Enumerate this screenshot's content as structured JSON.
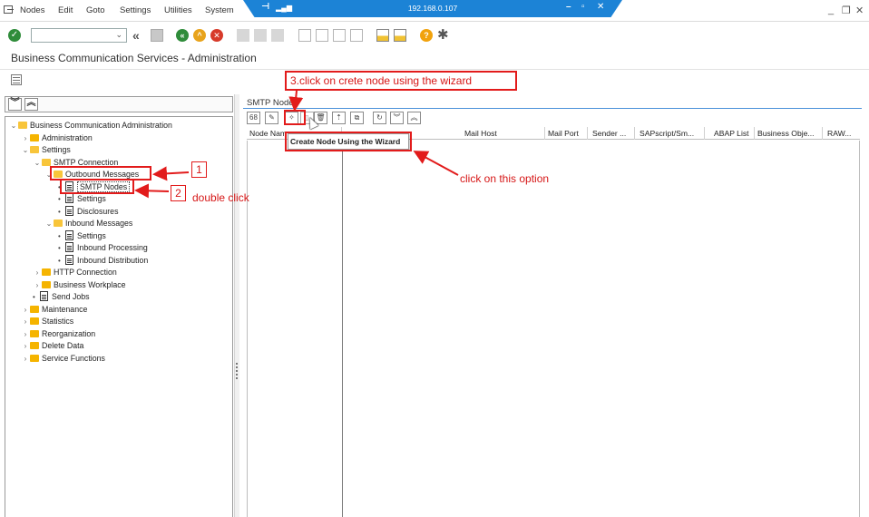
{
  "menubar": {
    "items": [
      {
        "label": "Nodes",
        "u": "N"
      },
      {
        "label": "Edit",
        "u": "E"
      },
      {
        "label": "Goto",
        "u": "G"
      },
      {
        "label": "Settings",
        "u": "S"
      },
      {
        "label": "Utilities",
        "u": "U"
      },
      {
        "label": "System",
        "u": "y"
      }
    ],
    "rdp_ip": "192.168.0.107"
  },
  "page_title": "Business Communication Services - Administration",
  "tree": {
    "root": "Business Communication Administration",
    "administration": "Administration",
    "settings": "Settings",
    "smtp_connection": "SMTP Connection",
    "outbound_messages": "Outbound Messages",
    "smtp_nodes": "SMTP Nodes",
    "settings_sub": "Settings",
    "disclosures": "Disclosures",
    "inbound_messages": "Inbound Messages",
    "inbound_settings": "Settings",
    "inbound_processing": "Inbound Processing",
    "inbound_distribution": "Inbound Distribution",
    "http_connection": "HTTP Connection",
    "business_workplace": "Business Workplace",
    "send_jobs": "Send Jobs",
    "maintenance": "Maintenance",
    "statistics": "Statistics",
    "reorganization": "Reorganization",
    "delete_data": "Delete Data",
    "service_functions": "Service Functions"
  },
  "right_panel": {
    "title": "SMTP Nodes",
    "columns": [
      "Node Nam",
      "Mail Host",
      "Mail Port",
      "Sender ...",
      "SAPscript/Sm...",
      "ABAP List",
      "Business Obje...",
      "RAW..."
    ],
    "tooltip": "Create Node Using the Wizard"
  },
  "annotations": {
    "step1": "1",
    "step2": "2",
    "double_click": "double click",
    "step3": "3.click on crete node using the wizard",
    "click_option": "click on this option"
  },
  "colors": {
    "annotation_red": "#e21b1b",
    "rdp_blue": "#1c83d6",
    "folder_yellow": "#f5b400"
  }
}
